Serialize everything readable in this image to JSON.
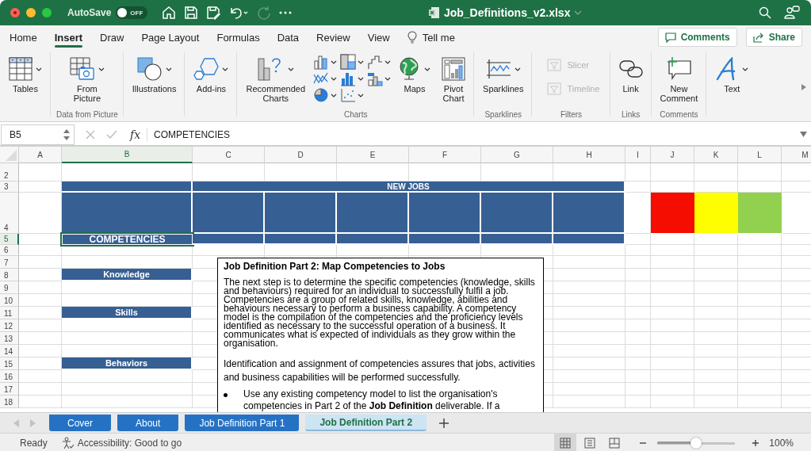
{
  "window": {
    "title": "Job_Definitions_v2.xlsx"
  },
  "autosave": {
    "label": "AutoSave",
    "on": false,
    "state_text": "OFF"
  },
  "menu_tabs": [
    {
      "label": "Home",
      "selected": false
    },
    {
      "label": "Insert",
      "selected": true
    },
    {
      "label": "Draw",
      "selected": false
    },
    {
      "label": "Page Layout",
      "selected": false
    },
    {
      "label": "Formulas",
      "selected": false
    },
    {
      "label": "Data",
      "selected": false
    },
    {
      "label": "Review",
      "selected": false
    },
    {
      "label": "View",
      "selected": false
    }
  ],
  "tell_me": "Tell me",
  "header_buttons": [
    "Comments",
    "Share"
  ],
  "ribbon": {
    "groups": [
      {
        "commands": [
          {
            "label": "Tables",
            "kind": "large",
            "dropdown": true,
            "disabled": false
          }
        ]
      },
      {
        "label": "Data from Picture",
        "commands": [
          {
            "label": "From Picture",
            "kind": "large",
            "two_line": true,
            "dropdown": true,
            "disabled": false
          }
        ]
      },
      {
        "commands": [
          {
            "label": "Illustrations",
            "kind": "large",
            "dropdown": true,
            "disabled": false
          }
        ]
      },
      {
        "commands": [
          {
            "label": "Add-ins",
            "kind": "large",
            "dropdown": true,
            "disabled": false
          }
        ]
      },
      {
        "label": "Charts",
        "commands": [
          {
            "label": "Recommended Charts",
            "kind": "large",
            "two_line": true,
            "dropdown": true,
            "disabled": false
          },
          {
            "kind": "chart-grid",
            "disabled": false
          },
          {
            "label": "Maps",
            "kind": "large",
            "dropdown": true,
            "disabled": false
          },
          {
            "label": "Pivot Chart",
            "kind": "large",
            "two_line": true,
            "dropdown": false,
            "disabled": false
          }
        ]
      },
      {
        "label": "Sparklines",
        "commands": [
          {
            "label": "Sparklines",
            "kind": "large",
            "dropdown": true,
            "disabled": false
          }
        ]
      },
      {
        "label": "Filters",
        "commands": [
          {
            "label": "Slicer",
            "kind": "small",
            "disabled": true
          },
          {
            "label": "Timeline",
            "kind": "small",
            "disabled": true
          }
        ]
      },
      {
        "label": "Links",
        "commands": [
          {
            "label": "Link",
            "kind": "large",
            "dropdown": false,
            "disabled": false
          }
        ]
      },
      {
        "label": "Comments",
        "commands": [
          {
            "label": "New Comment",
            "kind": "large",
            "two_line": true,
            "dropdown": false,
            "disabled": false
          }
        ]
      },
      {
        "commands": [
          {
            "label": "Text",
            "kind": "large",
            "dropdown": true,
            "disabled": false
          }
        ]
      }
    ]
  },
  "formula_bar": {
    "name_box": "B5",
    "function_label": "fx",
    "formula": "COMPETENCIES"
  },
  "sheet": {
    "columns": [
      {
        "label": "A",
        "selected": false
      },
      {
        "label": "B",
        "selected": true
      },
      {
        "label": "C",
        "selected": false
      },
      {
        "label": "D",
        "selected": false
      },
      {
        "label": "E",
        "selected": false
      },
      {
        "label": "F",
        "selected": false
      },
      {
        "label": "G",
        "selected": false
      },
      {
        "label": "H",
        "selected": false
      },
      {
        "label": "I",
        "selected": false
      },
      {
        "label": "J",
        "selected": false
      },
      {
        "label": "K",
        "selected": false
      },
      {
        "label": "L",
        "selected": false
      },
      {
        "label": "M",
        "selected": false
      }
    ],
    "rows": [
      {
        "number": "2",
        "selected": false
      },
      {
        "number": "3",
        "selected": false,
        "cells": [
          {
            "kind": "empty"
          },
          {
            "kind": "band",
            "selected": false
          },
          {
            "kind": "wide-band",
            "selected": false,
            "text": "NEW JOBS"
          }
        ]
      },
      {
        "number": "4",
        "selected": false,
        "cells": [
          {
            "kind": "empty"
          },
          {
            "kind": "band",
            "selected": false
          },
          {
            "kind": "band",
            "selected": false
          },
          {
            "kind": "band",
            "selected": false
          },
          {
            "kind": "band",
            "selected": false
          },
          {
            "kind": "band",
            "selected": false
          },
          {
            "kind": "band",
            "selected": false
          },
          {
            "kind": "band",
            "selected": false
          },
          {
            "kind": "empty"
          },
          {
            "kind": "fill",
            "selected": false,
            "color": "#f40d00"
          },
          {
            "kind": "fill",
            "selected": false,
            "color": "#fefe00"
          },
          {
            "kind": "fill",
            "selected": false,
            "color": "#92d050"
          }
        ]
      },
      {
        "number": "5",
        "selected": true,
        "cells": [
          {
            "kind": "empty"
          },
          {
            "kind": "band",
            "selected": true,
            "text": "COMPETENCIES"
          },
          {
            "kind": "band",
            "selected": false
          },
          {
            "kind": "band",
            "selected": false
          },
          {
            "kind": "band",
            "selected": false
          },
          {
            "kind": "band",
            "selected": false
          },
          {
            "kind": "band",
            "selected": false
          },
          {
            "kind": "band",
            "selected": false
          }
        ]
      },
      {
        "number": "6",
        "selected": false
      },
      {
        "number": "7",
        "selected": false
      },
      {
        "number": "8",
        "selected": false,
        "cells": [
          {
            "kind": "empty"
          },
          {
            "kind": "band",
            "selected": false,
            "text": "Knowledge"
          }
        ]
      },
      {
        "number": "9",
        "selected": false
      },
      {
        "number": "10",
        "selected": false
      },
      {
        "number": "11",
        "selected": false,
        "cells": [
          {
            "kind": "empty"
          },
          {
            "kind": "band",
            "selected": false,
            "text": "Skills"
          }
        ]
      },
      {
        "number": "12",
        "selected": false
      },
      {
        "number": "13",
        "selected": false
      },
      {
        "number": "14",
        "selected": false
      },
      {
        "number": "15",
        "selected": false,
        "cells": [
          {
            "kind": "empty"
          },
          {
            "kind": "band",
            "selected": false,
            "text": "Behaviors"
          }
        ]
      },
      {
        "number": "16",
        "selected": false
      },
      {
        "number": "17",
        "selected": false
      },
      {
        "number": "18",
        "selected": false
      }
    ]
  },
  "text_box": {
    "title": "Job Definition Part 2: Map Competencies to Jobs",
    "paragraphs": [
      "The next step is to determine the specific competencies (knowledge, skills and behaviours) required for an individual to successfully fulfil a job. Competencies are a group of related skills, knowledge, abilities and behaviours necessary to perform a business capability. A competency model is the compilation of the competencies and the proficiency levels identified as necessary to the successful operation of a business. It communicates what is expected of individuals as they grow within the organisation.",
      "Identification and assignment of competencies assures that jobs, activities and business capabilities will be performed successfully."
    ],
    "bullets": [
      "Use any existing competency model to list the organisation's competencies in Part 2 of the **Job Definition** deliverable. If a"
    ]
  },
  "sheet_tabs": [
    {
      "label": "Cover",
      "selected": false
    },
    {
      "label": "About",
      "selected": false
    },
    {
      "label": "Job Definition Part 1",
      "selected": false
    },
    {
      "label": "Job Definition Part 2",
      "selected": true
    }
  ],
  "status_bar": {
    "status": "Ready",
    "accessibility": "Accessibility: Good to go",
    "views": [
      {
        "selected": true
      },
      {
        "selected": false
      },
      {
        "selected": false
      }
    ],
    "zoom": {
      "level": 0.5,
      "reading": "100%"
    }
  }
}
